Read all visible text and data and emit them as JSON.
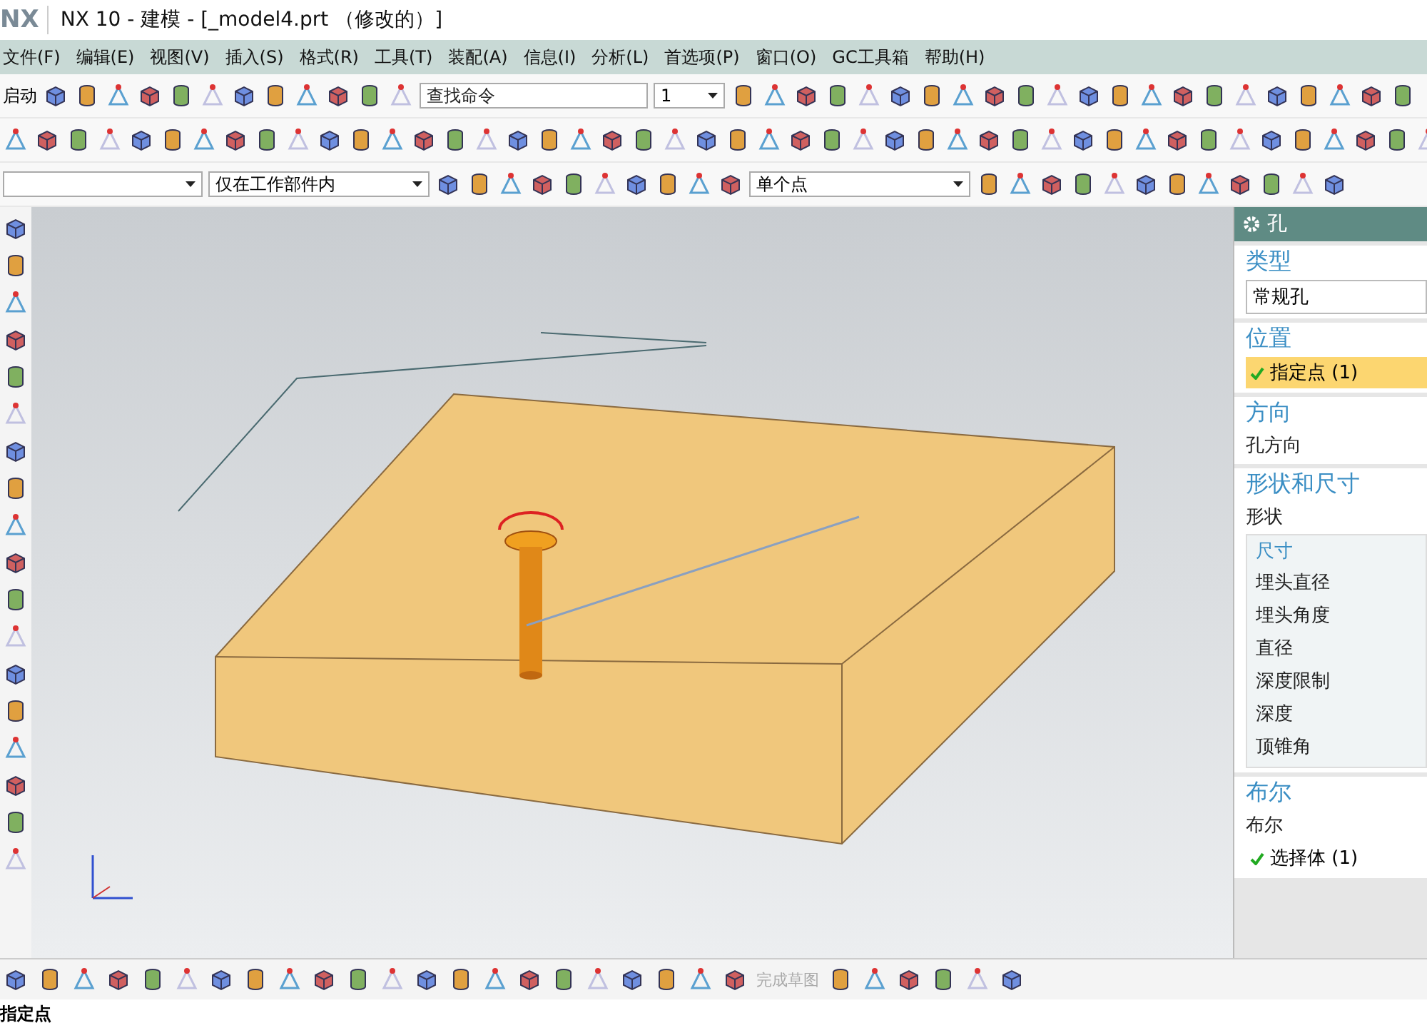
{
  "window": {
    "logo": "NX",
    "title": "NX 10 - 建模 - [_model4.prt （修改的）]"
  },
  "menu": [
    "文件(F)",
    "编辑(E)",
    "视图(V)",
    "插入(S)",
    "格式(R)",
    "工具(T)",
    "装配(A)",
    "信息(I)",
    "分析(L)",
    "首选项(P)",
    "窗口(O)",
    "GC工具箱",
    "帮助(H)"
  ],
  "toolbar": {
    "start": "启动",
    "search": {
      "placeholder": "查找命令"
    },
    "layer": "1"
  },
  "selection_bar": {
    "scope": "仅在工作部件内",
    "snap": "单个点"
  },
  "dialog": {
    "title": "孔",
    "sections": [
      {
        "title": "类型",
        "rows": [
          {
            "kind": "dropdown",
            "label": "常规孔"
          }
        ]
      },
      {
        "title": "位置",
        "rows": [
          {
            "kind": "selection",
            "label": "指定点 (1)",
            "checked": true,
            "selected": true
          }
        ]
      },
      {
        "title": "方向",
        "rows": [
          {
            "kind": "text",
            "label": "孔方向"
          }
        ]
      },
      {
        "title": "形状和尺寸",
        "rows": [
          {
            "kind": "text",
            "label": "形状"
          },
          {
            "kind": "group",
            "label": "尺寸",
            "items": [
              "埋头直径",
              "埋头角度",
              "直径",
              "深度限制",
              "深度",
              "顶锥角"
            ]
          }
        ]
      },
      {
        "title": "布尔",
        "rows": [
          {
            "kind": "text",
            "label": "布尔"
          },
          {
            "kind": "selection",
            "label": "选择体 (1)",
            "checked": true,
            "selected": false
          }
        ]
      }
    ]
  },
  "bottom_toolbar": {
    "finish_sketch": {
      "label": "完成草图",
      "disabled": true
    }
  },
  "status_bar": "指定点"
}
